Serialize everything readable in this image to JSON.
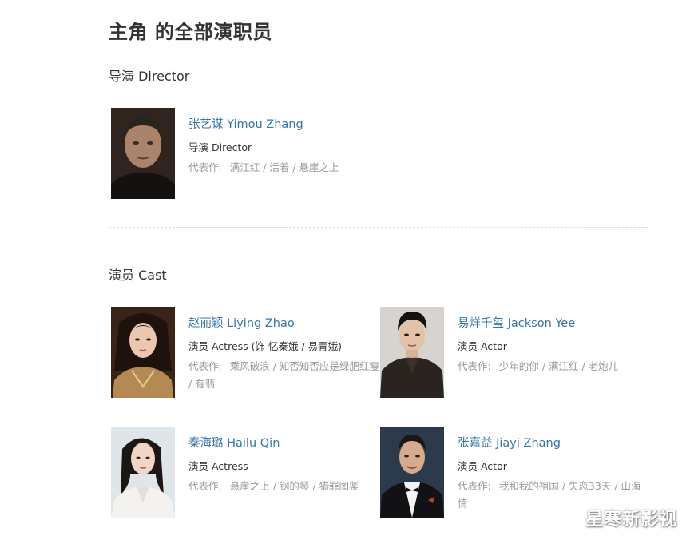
{
  "page": {
    "title": "主角 的全部演职员"
  },
  "sections": {
    "director": {
      "heading": "导演 Director"
    },
    "cast": {
      "heading": "演员 Cast"
    }
  },
  "people": {
    "director": {
      "name": "张艺谋 Yimou Zhang",
      "role": "导演 Director",
      "works_label": "代表作:",
      "works": "满江红 / 活着 / 悬崖之上"
    },
    "zhao": {
      "name": "赵丽颖 Liying Zhao",
      "role": "演员 Actress (饰 忆秦娥 / 易青娥)",
      "works_label": "代表作:",
      "works": "乘风破浪 / 知否知否应是绿肥红瘦 / 有翡"
    },
    "yee": {
      "name": "易烊千玺 Jackson Yee",
      "role": "演员 Actor",
      "works_label": "代表作:",
      "works": "少年的你 / 满江红 / 老炮儿"
    },
    "qin": {
      "name": "秦海璐 Hailu Qin",
      "role": "演员 Actress",
      "works_label": "代表作:",
      "works": "悬崖之上 / 钢的琴 / 猎罪图鉴"
    },
    "zhang": {
      "name": "张嘉益 Jiayi Zhang",
      "role": "演员 Actor",
      "works_label": "代表作:",
      "works": "我和我的祖国 / 失恋33天 / 山海情"
    }
  },
  "watermark": "星寒新影视"
}
